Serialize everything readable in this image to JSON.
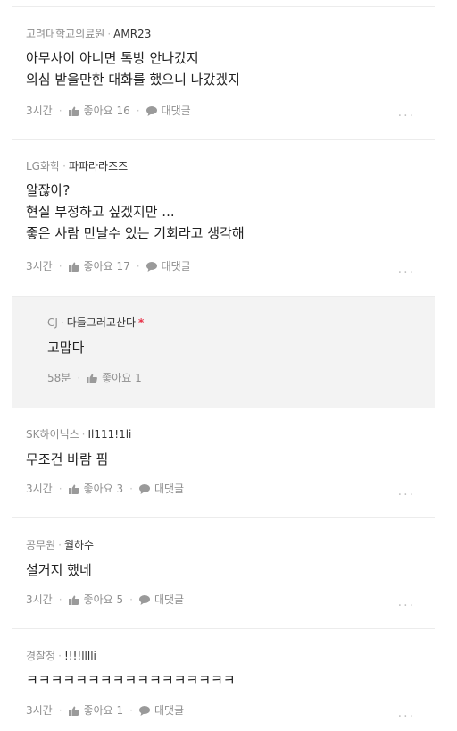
{
  "comments": [
    {
      "company": "고려대학교의료원",
      "nickname": "AMR23",
      "lines": [
        "아무사이 아니면 톡방 안나갔지",
        "의심 받을만한 대화를 했으니 나갔겠지"
      ],
      "time": "3시간",
      "like_label": "좋아요 16",
      "reply_label": "대댓글"
    },
    {
      "company": "LG화학",
      "nickname": "파파라라즈즈",
      "lines": [
        "알잖아?",
        "현실 부정하고 싶겠지만 ...",
        "좋은 사람 만날수 있는 기회라고 생각해"
      ],
      "time": "3시간",
      "like_label": "좋아요 17",
      "reply_label": "대댓글"
    },
    {
      "company": "CJ",
      "nickname": "다들그러고산다",
      "op_mark": "*",
      "lines": [
        "고맙다"
      ],
      "time": "58분",
      "like_label": "좋아요 1"
    },
    {
      "company": "SK하이닉스",
      "nickname": "Il111!1li",
      "lines": [
        "무조건 바람 핌"
      ],
      "time": "3시간",
      "like_label": "좋아요 3",
      "reply_label": "대댓글"
    },
    {
      "company": "공무원",
      "nickname": "월하수",
      "lines": [
        "설거지 했네"
      ],
      "time": "3시간",
      "like_label": "좋아요 5",
      "reply_label": "대댓글"
    },
    {
      "company": "경찰청",
      "nickname": "!!!!lllli",
      "lines": [
        "ㅋㅋㅋㅋㅋㅋㅋㅋㅋㅋㅋㅋㅋㅋㅋㅋㅋ"
      ],
      "time": "3시간",
      "like_label": "좋아요 1",
      "reply_label": "대댓글"
    }
  ],
  "meta_separator": "·",
  "more_label": "...",
  "icons": {
    "like": "thumbs-up-icon",
    "reply": "speech-bubble-icon",
    "more": "more-dots-icon"
  },
  "colors": {
    "op_mark": "#e8334a",
    "reply_bg": "#f3f3f3",
    "muted": "#8f8f8f"
  }
}
